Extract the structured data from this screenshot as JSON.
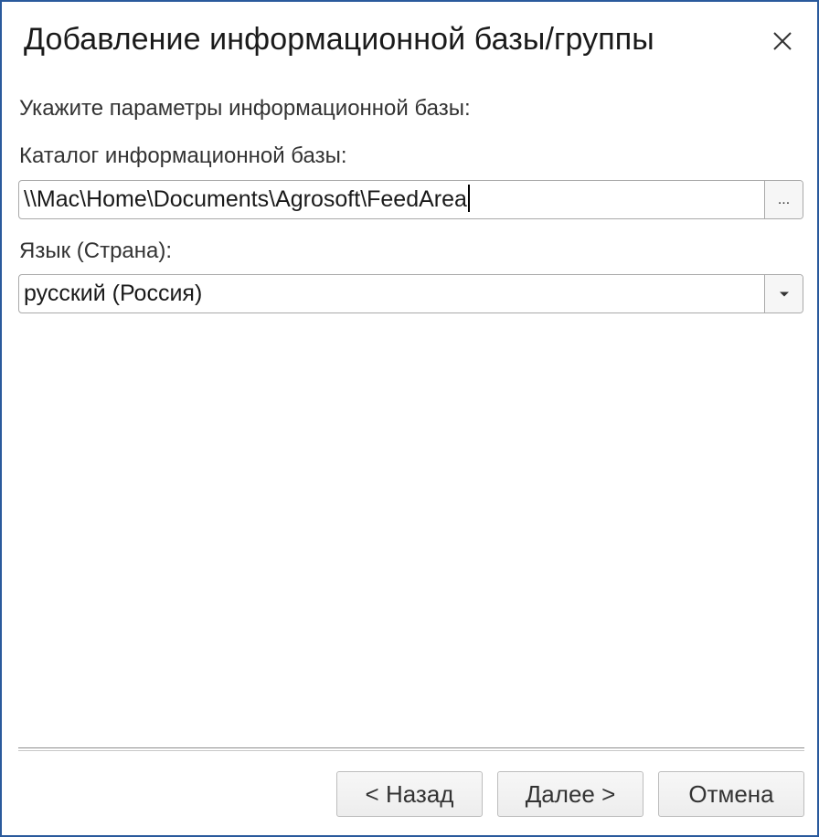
{
  "dialog": {
    "title": "Добавление информационной базы/группы",
    "close_icon": "close-icon"
  },
  "form": {
    "intro": "Укажите параметры информационной базы:",
    "catalog": {
      "label": "Каталог информационной базы:",
      "value": "\\\\Mac\\Home\\Documents\\Agrosoft\\FeedArea",
      "browse_label": "..."
    },
    "language": {
      "label": "Язык (Страна):",
      "value": "русский (Россия)",
      "dropdown_icon": "chevron-down-icon"
    }
  },
  "buttons": {
    "back": "< Назад",
    "next": "Далее >",
    "cancel": "Отмена"
  },
  "colors": {
    "border_accent": "#2a5a9c",
    "field_border": "#a9a9a9"
  }
}
